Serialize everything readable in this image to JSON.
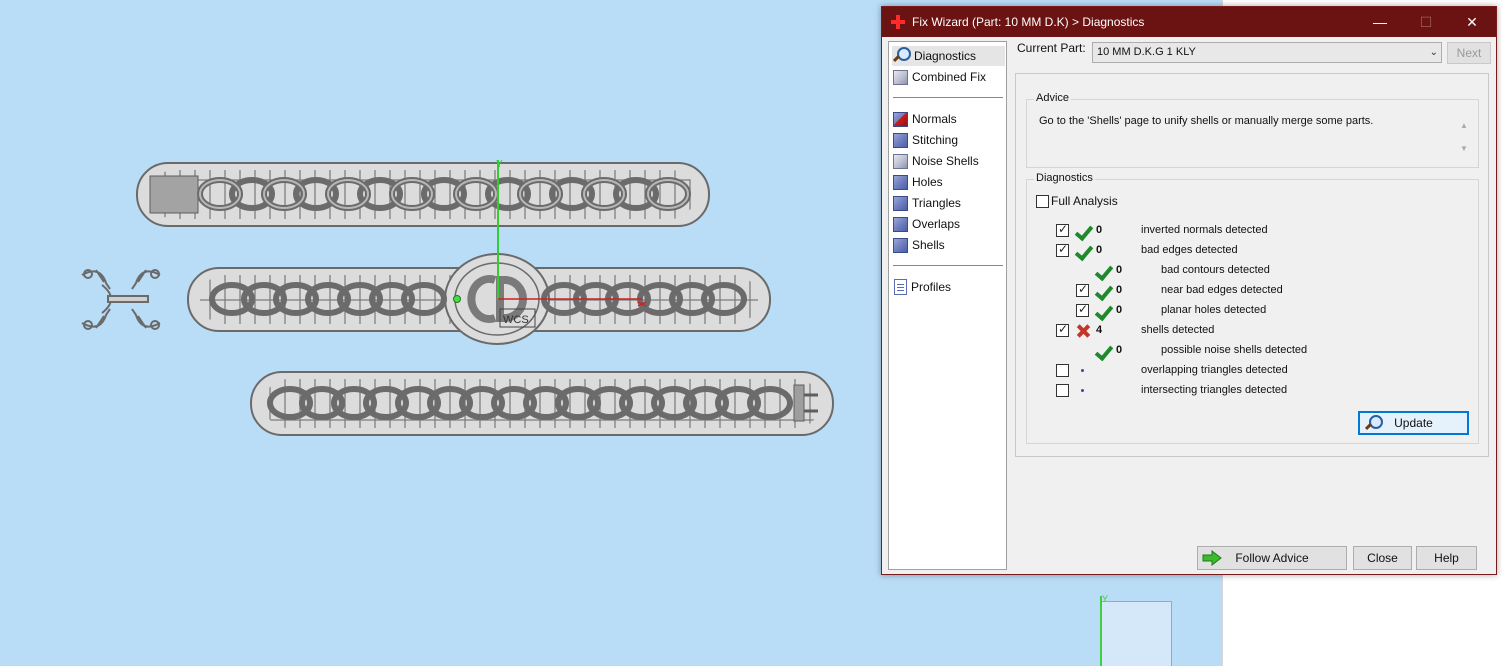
{
  "dialog": {
    "title": "Fix Wizard (Part: 10 MM D.K) > Diagnostics",
    "win_min": "—",
    "win_max": "☐",
    "win_close": "✕"
  },
  "nav": {
    "items": [
      {
        "label": "Diagnostics",
        "icon": "magnifier-icon"
      },
      {
        "label": "Combined Fix",
        "icon": "cube-icon"
      },
      {
        "label": "Normals",
        "icon": "normals-cube-icon"
      },
      {
        "label": "Stitching",
        "icon": "stitching-cube-icon"
      },
      {
        "label": "Noise Shells",
        "icon": "noise-shells-icon"
      },
      {
        "label": "Holes",
        "icon": "holes-cube-icon"
      },
      {
        "label": "Triangles",
        "icon": "triangles-cube-icon"
      },
      {
        "label": "Overlaps",
        "icon": "overlaps-cube-icon"
      },
      {
        "label": "Shells",
        "icon": "shells-cube-icon"
      },
      {
        "label": "Profiles",
        "icon": "document-icon"
      }
    ]
  },
  "current_part": {
    "label": "Current Part:",
    "value": "10 MM D.K.G 1 KLY",
    "next_label": "Next"
  },
  "advice": {
    "title": "Advice",
    "text": "Go to the 'Shells' page to unify shells or manually merge some parts."
  },
  "diagnostics": {
    "title": "Diagnostics",
    "full_analysis_label": "Full Analysis",
    "rows": [
      {
        "count": "0",
        "label": "inverted normals detected",
        "status": "ok"
      },
      {
        "count": "0",
        "label": "bad edges detected",
        "status": "ok"
      },
      {
        "count": "0",
        "label": "bad contours detected",
        "status": "ok"
      },
      {
        "count": "0",
        "label": "near bad edges detected",
        "status": "ok"
      },
      {
        "count": "0",
        "label": "planar holes detected",
        "status": "ok"
      },
      {
        "count": "4",
        "label": "shells detected",
        "status": "fail"
      },
      {
        "count": "0",
        "label": "possible noise shells detected",
        "status": "ok"
      },
      {
        "count": "",
        "label": "overlapping triangles detected",
        "status": "dot"
      },
      {
        "count": "",
        "label": "intersecting triangles detected",
        "status": "dot"
      }
    ],
    "update_label": "Update"
  },
  "buttons": {
    "follow_advice": "Follow Advice",
    "close": "Close",
    "help": "Help"
  },
  "viewport": {
    "wcs_label": "WCS",
    "axis_y_label": "Y",
    "mini_axis_label": "Y"
  },
  "colors": {
    "titlebar": "#6b1212",
    "viewport_bg": "#b9dcf7",
    "ok": "#1e8a2b",
    "fail": "#c4352a",
    "accent": "#0078d7"
  }
}
